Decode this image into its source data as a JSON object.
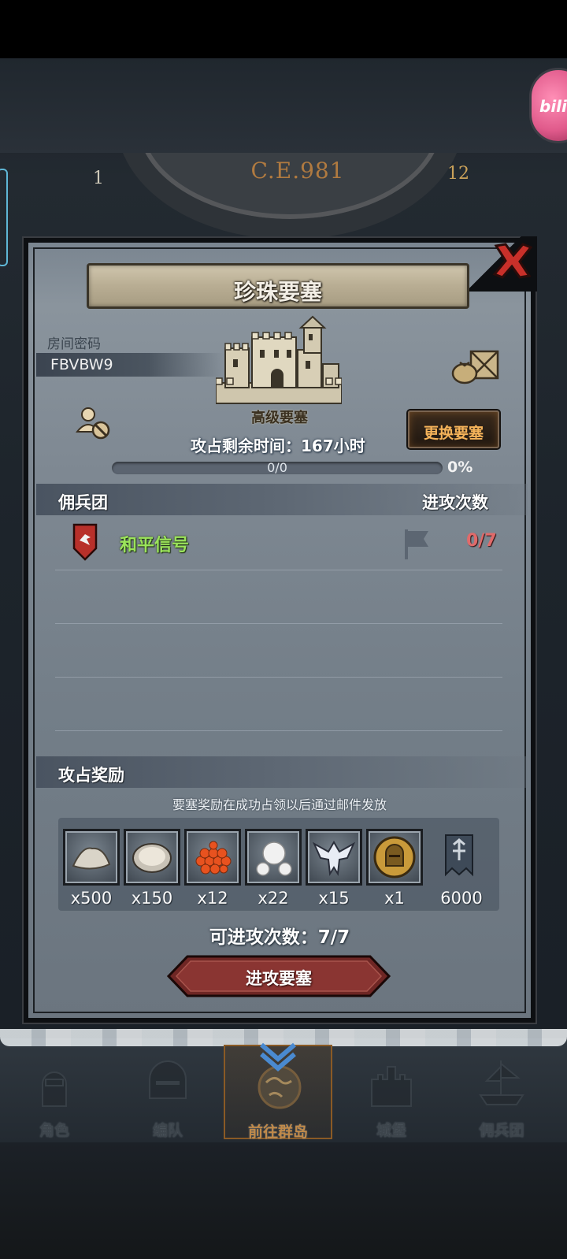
{
  "header": {
    "era": "C.E.981",
    "dial_left": "1",
    "dial_right": "12"
  },
  "overlay": {
    "bili_text": "bili"
  },
  "dialog": {
    "title": "珍珠要塞",
    "room_label": "房间密码",
    "room_code": "FBVBW9",
    "fortress_level": "高级要塞",
    "change_button": "更换要塞",
    "timer_text": "攻占剩余时间：167小时",
    "progress": {
      "text": "0/0",
      "percent_text": "0%",
      "fraction": 0
    },
    "mercenary_section": {
      "title": "佣兵团",
      "right_title": "进攻次数"
    },
    "mercenaries": [
      {
        "name": "和平信号",
        "attacks": "0/7"
      }
    ],
    "rewards_section": {
      "title": "攻占奖励",
      "note": "要塞奖励在成功占领以后通过邮件发放"
    },
    "rewards": [
      {
        "icon": "salt-pile-icon",
        "qty": "x500"
      },
      {
        "icon": "oyster-icon",
        "qty": "x150"
      },
      {
        "icon": "fish-roe-icon",
        "qty": "x12"
      },
      {
        "icon": "pearls-icon",
        "qty": "x22"
      },
      {
        "icon": "winged-emblem-icon",
        "qty": "x15"
      },
      {
        "icon": "knight-medal-icon",
        "qty": "x1"
      },
      {
        "icon": "guild-banner-icon",
        "qty": "6000"
      }
    ],
    "remaining_attacks": "可进攻次数：7/7",
    "attack_button": "进攻要塞"
  },
  "bottom_nav": [
    {
      "label": "角色",
      "icon": "knight-icon",
      "active": false
    },
    {
      "label": "编队",
      "icon": "helmet-icon",
      "active": false
    },
    {
      "label": "前往群岛",
      "icon": "globe-icon",
      "active": true
    },
    {
      "label": "城堡",
      "icon": "castle-icon",
      "active": false
    },
    {
      "label": "佣兵团",
      "icon": "ship-icon",
      "active": false
    }
  ],
  "colors": {
    "guild_name": "#9be35b",
    "attack_count": "#e06a6a",
    "change_button_text": "#f5b35a",
    "attack_button": "#7a2a28"
  }
}
